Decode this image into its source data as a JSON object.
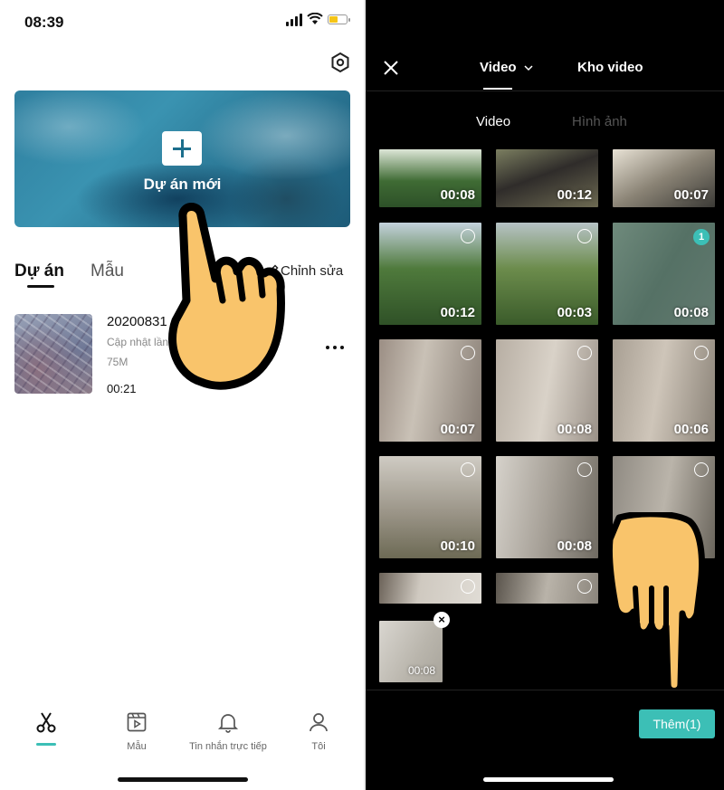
{
  "left_screen": {
    "status_time": "08:39",
    "hero": {
      "label": "Dự án mới",
      "icon": "plus-icon"
    },
    "tabs": [
      {
        "label": "Dự án",
        "active": true
      },
      {
        "label": "Mẫu",
        "active": false
      }
    ],
    "edit_label": "Chỉnh sửa",
    "project": {
      "name": "20200831",
      "updated": "Cập nhật lần",
      "size": "75M",
      "duration": "00:21"
    },
    "nav": [
      {
        "label": "",
        "icon": "scissors-icon",
        "active": true
      },
      {
        "label": "Mẫu",
        "icon": "template-icon"
      },
      {
        "label": "Tin nhắn trực tiếp",
        "icon": "bell-icon"
      },
      {
        "label": "Tôi",
        "icon": "user-icon"
      }
    ]
  },
  "right_screen": {
    "tabs": [
      {
        "label": "Video",
        "active": true
      },
      {
        "label": "Kho video",
        "active": false
      }
    ],
    "subtabs": [
      {
        "label": "Video",
        "active": true
      },
      {
        "label": "Hình ảnh",
        "active": false
      }
    ],
    "grid": [
      {
        "duration": "00:08"
      },
      {
        "duration": "00:12"
      },
      {
        "duration": "00:07"
      },
      {
        "duration": "00:12"
      },
      {
        "duration": "00:03"
      },
      {
        "duration": "00:08",
        "selected": "1"
      },
      {
        "duration": "00:07"
      },
      {
        "duration": "00:08"
      },
      {
        "duration": "00:06"
      },
      {
        "duration": "00:10"
      },
      {
        "duration": "00:08"
      },
      {
        "duration": ""
      },
      {
        "duration": ""
      },
      {
        "duration": ""
      }
    ],
    "tray": {
      "duration": "00:08",
      "remove_icon": "×"
    },
    "add_button": "Thêm(1)"
  },
  "colors": {
    "accent": "#3cbfb6",
    "hand": "#f9c46b"
  }
}
